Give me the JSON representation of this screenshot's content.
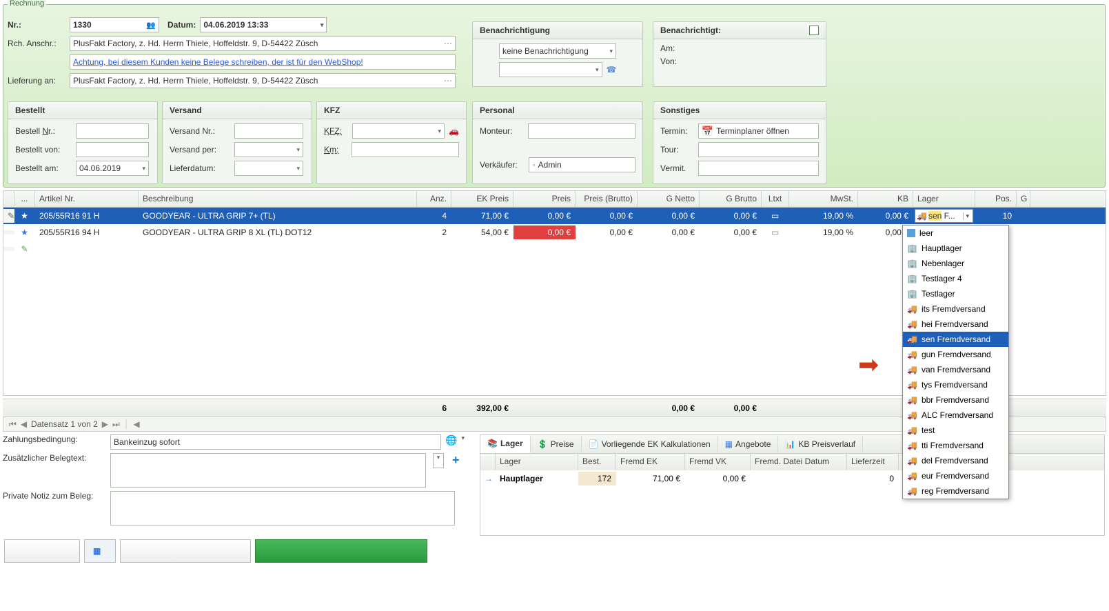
{
  "rechnung": {
    "legend": "Rechnung",
    "nr_label": "Nr.:",
    "nr_value": "1330",
    "datum_label": "Datum:",
    "datum_value": "04.06.2019 13:33",
    "rch_anschr_label": "Rch. Anschr.:",
    "rch_anschr_value": "PlusFakt Factory, z. Hd. Herrn Thiele, Hoffeldstr. 9,  D-54422 Züsch",
    "warning": "Achtung, bei diesem Kunden keine Belege schreiben, der ist für den WebShop!",
    "lieferung_label": "Lieferung an:",
    "lieferung_value": "PlusFakt Factory, z. Hd. Herrn Thiele, Hoffeldstr. 9,  D-54422 Züsch"
  },
  "benachrichtigung": {
    "title": "Benachrichtigung",
    "select_value": "keine Benachrichtigung"
  },
  "benachrichtigt": {
    "title": "Benachrichtigt:",
    "am_label": "Am:",
    "von_label": "Von:"
  },
  "bestellt": {
    "title": "Bestellt",
    "nr_label": "Bestell Nr.:",
    "von_label": "Bestellt von:",
    "am_label": "Bestellt am:",
    "am_value": "04.06.2019"
  },
  "versand": {
    "title": "Versand",
    "nr_label": "Versand Nr.:",
    "per_label": "Versand per:",
    "lieferdatum_label": "Lieferdatum:"
  },
  "kfz": {
    "title": "KFZ",
    "kfz_label": "KFZ:",
    "km_label": "Km:"
  },
  "personal": {
    "title": "Personal",
    "monteur_label": "Monteur:",
    "verkaufer_label": "Verkäufer:",
    "verkaufer_value": "Admin"
  },
  "sonstiges": {
    "title": "Sonstiges",
    "termin_label": "Termin:",
    "termin_link": "Terminplaner öffnen",
    "tour_label": "Tour:",
    "vermit_label": "Vermit."
  },
  "grid": {
    "headers": {
      "more": "...",
      "artikel": "Artikel Nr.",
      "beschreibung": "Beschreibung",
      "anz": "Anz.",
      "ek": "EK Preis",
      "preis": "Preis",
      "brutto": "Preis (Brutto)",
      "gnetto": "G Netto",
      "gbrutto": "G Brutto",
      "ltxt": "Ltxt",
      "mwst": "MwSt.",
      "kb": "KB",
      "lager": "Lager",
      "pos": "Pos.",
      "g": "G"
    },
    "rows": [
      {
        "artikel": "205/55R16 91 H",
        "beschreibung": "GOODYEAR - ULTRA GRIP 7+ (TL)",
        "anz": "4",
        "ek": "71,00 €",
        "preis": "0,00 €",
        "brutto": "0,00 €",
        "gnetto": "0,00 €",
        "gbrutto": "0,00 €",
        "mwst": "19,00 %",
        "kb": "0,00 €",
        "lager": "sen F...",
        "pos": "10",
        "selected": true
      },
      {
        "artikel": "205/55R16 94 H",
        "beschreibung": "GOODYEAR - ULTRA GRIP 8 XL (TL) DOT12",
        "anz": "2",
        "ek": "54,00 €",
        "preis": "0,00 €",
        "brutto": "0,00 €",
        "gnetto": "0,00 €",
        "gbrutto": "0,00 €",
        "mwst": "19,00 %",
        "kb": "0,00 €",
        "lager": "",
        "pos": "",
        "preis_red": true
      }
    ],
    "totals": {
      "anz": "6",
      "ek": "392,00 €",
      "gnetto": "0,00 €",
      "gbrutto": "0,00 €"
    }
  },
  "pager": {
    "text": "Datensatz 1 von 2"
  },
  "payment": {
    "zahlungsbedingung_label": "Zahlungsbedingung:",
    "zahlungsbedingung_value": "Bankeinzug sofort",
    "zusatztext_label": "Zusätzlicher Belegtext:",
    "privatenotiz_label": "Private Notiz zum Beleg:"
  },
  "tabs": {
    "lager": "Lager",
    "preise": "Preise",
    "vorliegende": "Vorliegende EK Kalkulationen",
    "angebote": "Angebote",
    "kb": "KB Preisverlauf"
  },
  "subgrid": {
    "headers": {
      "lager": "Lager",
      "best": "Best.",
      "fek": "Fremd EK",
      "fvk": "Fremd VK",
      "datum": "Fremd. Datei Datum",
      "lieferzeit": "Lieferzeit"
    },
    "row": {
      "lager": "Hauptlager",
      "best": "172",
      "fek": "71,00 €",
      "fvk": "0,00 €",
      "datum": "",
      "lieferzeit": "0"
    }
  },
  "dropdown": {
    "options": [
      {
        "label": "leer",
        "icon": "empty"
      },
      {
        "label": "Hauptlager",
        "icon": "building"
      },
      {
        "label": "Nebenlager",
        "icon": "building"
      },
      {
        "label": "Testlager 4",
        "icon": "building"
      },
      {
        "label": "Testlager",
        "icon": "building"
      },
      {
        "label": "its Fremdversand",
        "icon": "truck"
      },
      {
        "label": "hei Fremdversand",
        "icon": "truck"
      },
      {
        "label": "sen Fremdversand",
        "icon": "truck",
        "selected": true
      },
      {
        "label": "gun Fremdversand",
        "icon": "truck"
      },
      {
        "label": "van Fremdversand",
        "icon": "truck"
      },
      {
        "label": "tys Fremdversand",
        "icon": "truck"
      },
      {
        "label": "bbr Fremdversand",
        "icon": "truck"
      },
      {
        "label": "ALC Fremdversand",
        "icon": "truck"
      },
      {
        "label": "test",
        "icon": "truck"
      },
      {
        "label": "tti Fremdversand",
        "icon": "truck"
      },
      {
        "label": "del Fremdversand",
        "icon": "truck"
      },
      {
        "label": "eur Fremdversand",
        "icon": "truck"
      },
      {
        "label": "reg Fremdversand",
        "icon": "truck"
      }
    ]
  }
}
